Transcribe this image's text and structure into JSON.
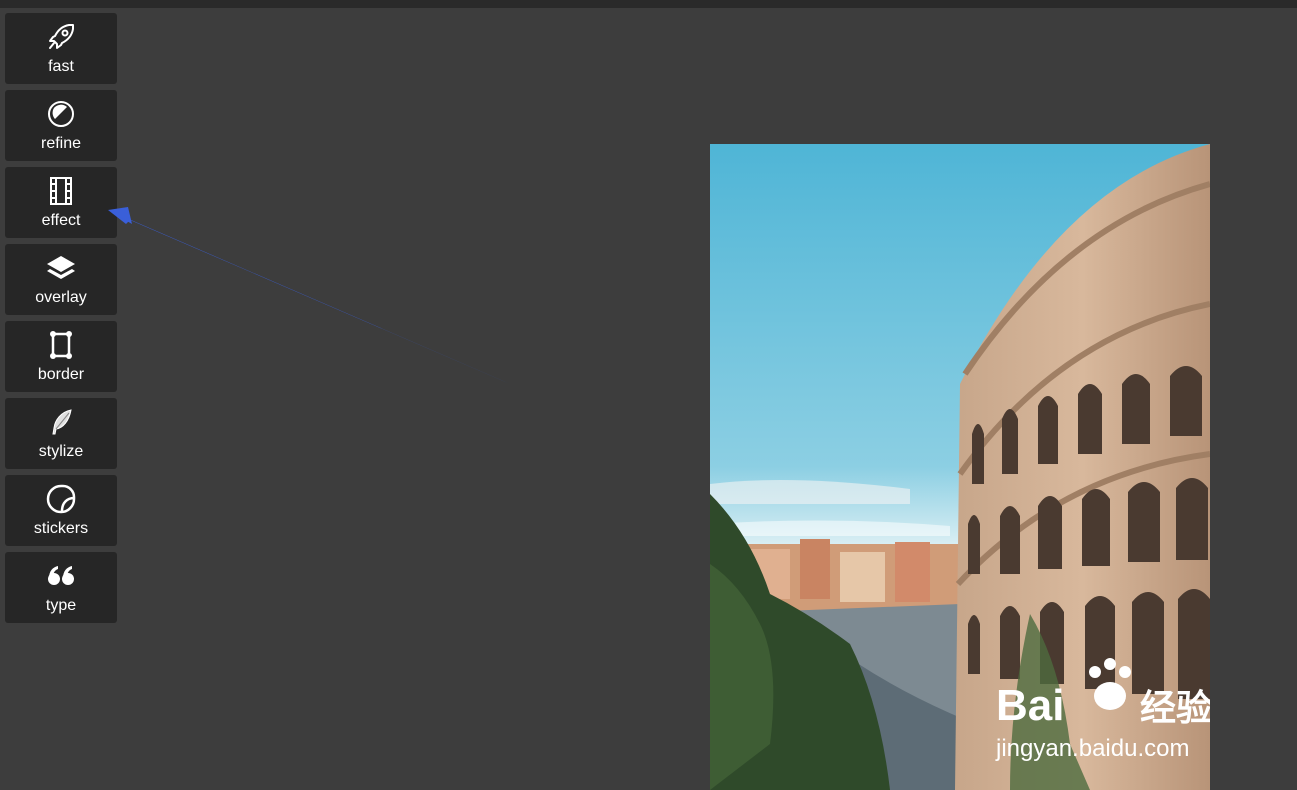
{
  "tools": [
    {
      "name": "fast",
      "icon": "rocket-icon"
    },
    {
      "name": "refine",
      "icon": "refine-icon"
    },
    {
      "name": "effect",
      "icon": "film-icon"
    },
    {
      "name": "overlay",
      "icon": "layers-icon"
    },
    {
      "name": "border",
      "icon": "frame-icon"
    },
    {
      "name": "stylize",
      "icon": "feather-icon"
    },
    {
      "name": "stickers",
      "icon": "sticker-icon"
    },
    {
      "name": "type",
      "icon": "quote-icon"
    }
  ],
  "annotation": {
    "color": "#3a5fd9"
  },
  "watermark": {
    "brand": "Bai",
    "brand_suffix": "经验",
    "url": "jingyan.baidu.com"
  },
  "colors": {
    "background": "#3d3d3d",
    "tool_bg": "#262626",
    "text": "#ffffff"
  }
}
